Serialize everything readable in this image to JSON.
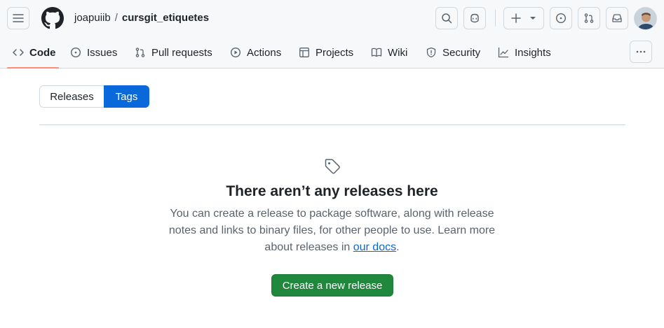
{
  "header": {
    "owner": "joapuiib",
    "separator": "/",
    "repo": "cursgit_etiquetes"
  },
  "tabs": [
    {
      "label": "Code",
      "icon": "code-icon"
    },
    {
      "label": "Issues",
      "icon": "issue-opened-icon"
    },
    {
      "label": "Pull requests",
      "icon": "git-pull-request-icon"
    },
    {
      "label": "Actions",
      "icon": "play-icon"
    },
    {
      "label": "Projects",
      "icon": "table-icon"
    },
    {
      "label": "Wiki",
      "icon": "book-icon"
    },
    {
      "label": "Security",
      "icon": "shield-icon"
    },
    {
      "label": "Insights",
      "icon": "graph-icon"
    }
  ],
  "segmented": {
    "releases": "Releases",
    "tags": "Tags"
  },
  "blankslate": {
    "title": "There aren’t any releases here",
    "line1": "You can create a release to package software, along with",
    "line2": "release notes and links to binary files, for other people to use.",
    "line3_before": "Learn more about releases in",
    "line3_link": "our docs",
    "line3_after": ".",
    "button": "Create a new release"
  },
  "colors": {
    "accent": "#0969da",
    "primary_button": "#1f883d",
    "active_tab_underline": "#fd8c73"
  }
}
